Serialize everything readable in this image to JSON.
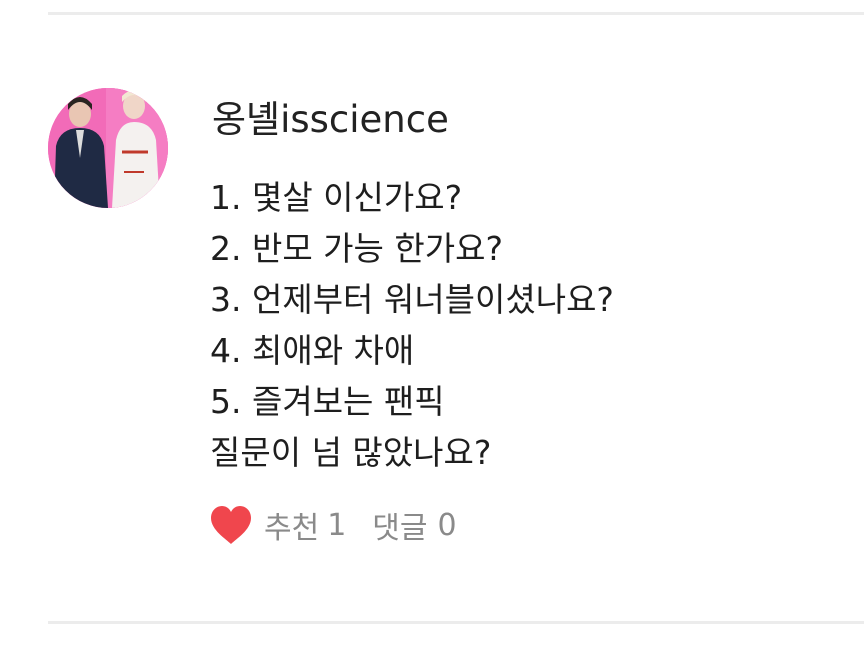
{
  "post": {
    "username": "옹녤isscience",
    "lines": [
      "1. 몇살 이신가요?",
      "2. 반모 가능 한가요?",
      "3. 언제부터 워너블이셨나요?",
      "4. 최애와 차애",
      "5. 즐겨보는 팬픽",
      "질문이 넘 많았나요?"
    ]
  },
  "actions": {
    "like_label": "추천",
    "like_count": "1",
    "comment_label": "댓글",
    "comment_count": "0",
    "heart_icon": "heart-icon",
    "heart_color": "#f0464d"
  },
  "colors": {
    "avatar_background": "#f26bb8",
    "text": "#1e1e1e",
    "muted": "#8a8a8a",
    "divider": "#ececec"
  }
}
